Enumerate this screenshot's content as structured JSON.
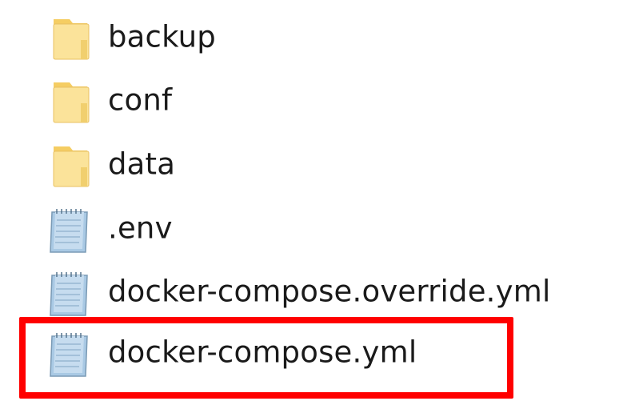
{
  "items": [
    {
      "name": "backup",
      "type": "folder"
    },
    {
      "name": "conf",
      "type": "folder"
    },
    {
      "name": "data",
      "type": "folder"
    },
    {
      "name": ".env",
      "type": "file"
    },
    {
      "name": "docker-compose.override.yml",
      "type": "file"
    },
    {
      "name": "docker-compose.yml",
      "type": "file",
      "highlighted": true
    }
  ],
  "colors": {
    "folder_fill": "#f9d97a",
    "folder_light": "#fbe7a6",
    "file_blue": "#9fc3e0",
    "highlight": "#ff0000"
  },
  "icons": {
    "folder": "folder-icon",
    "file": "text-document-icon"
  }
}
